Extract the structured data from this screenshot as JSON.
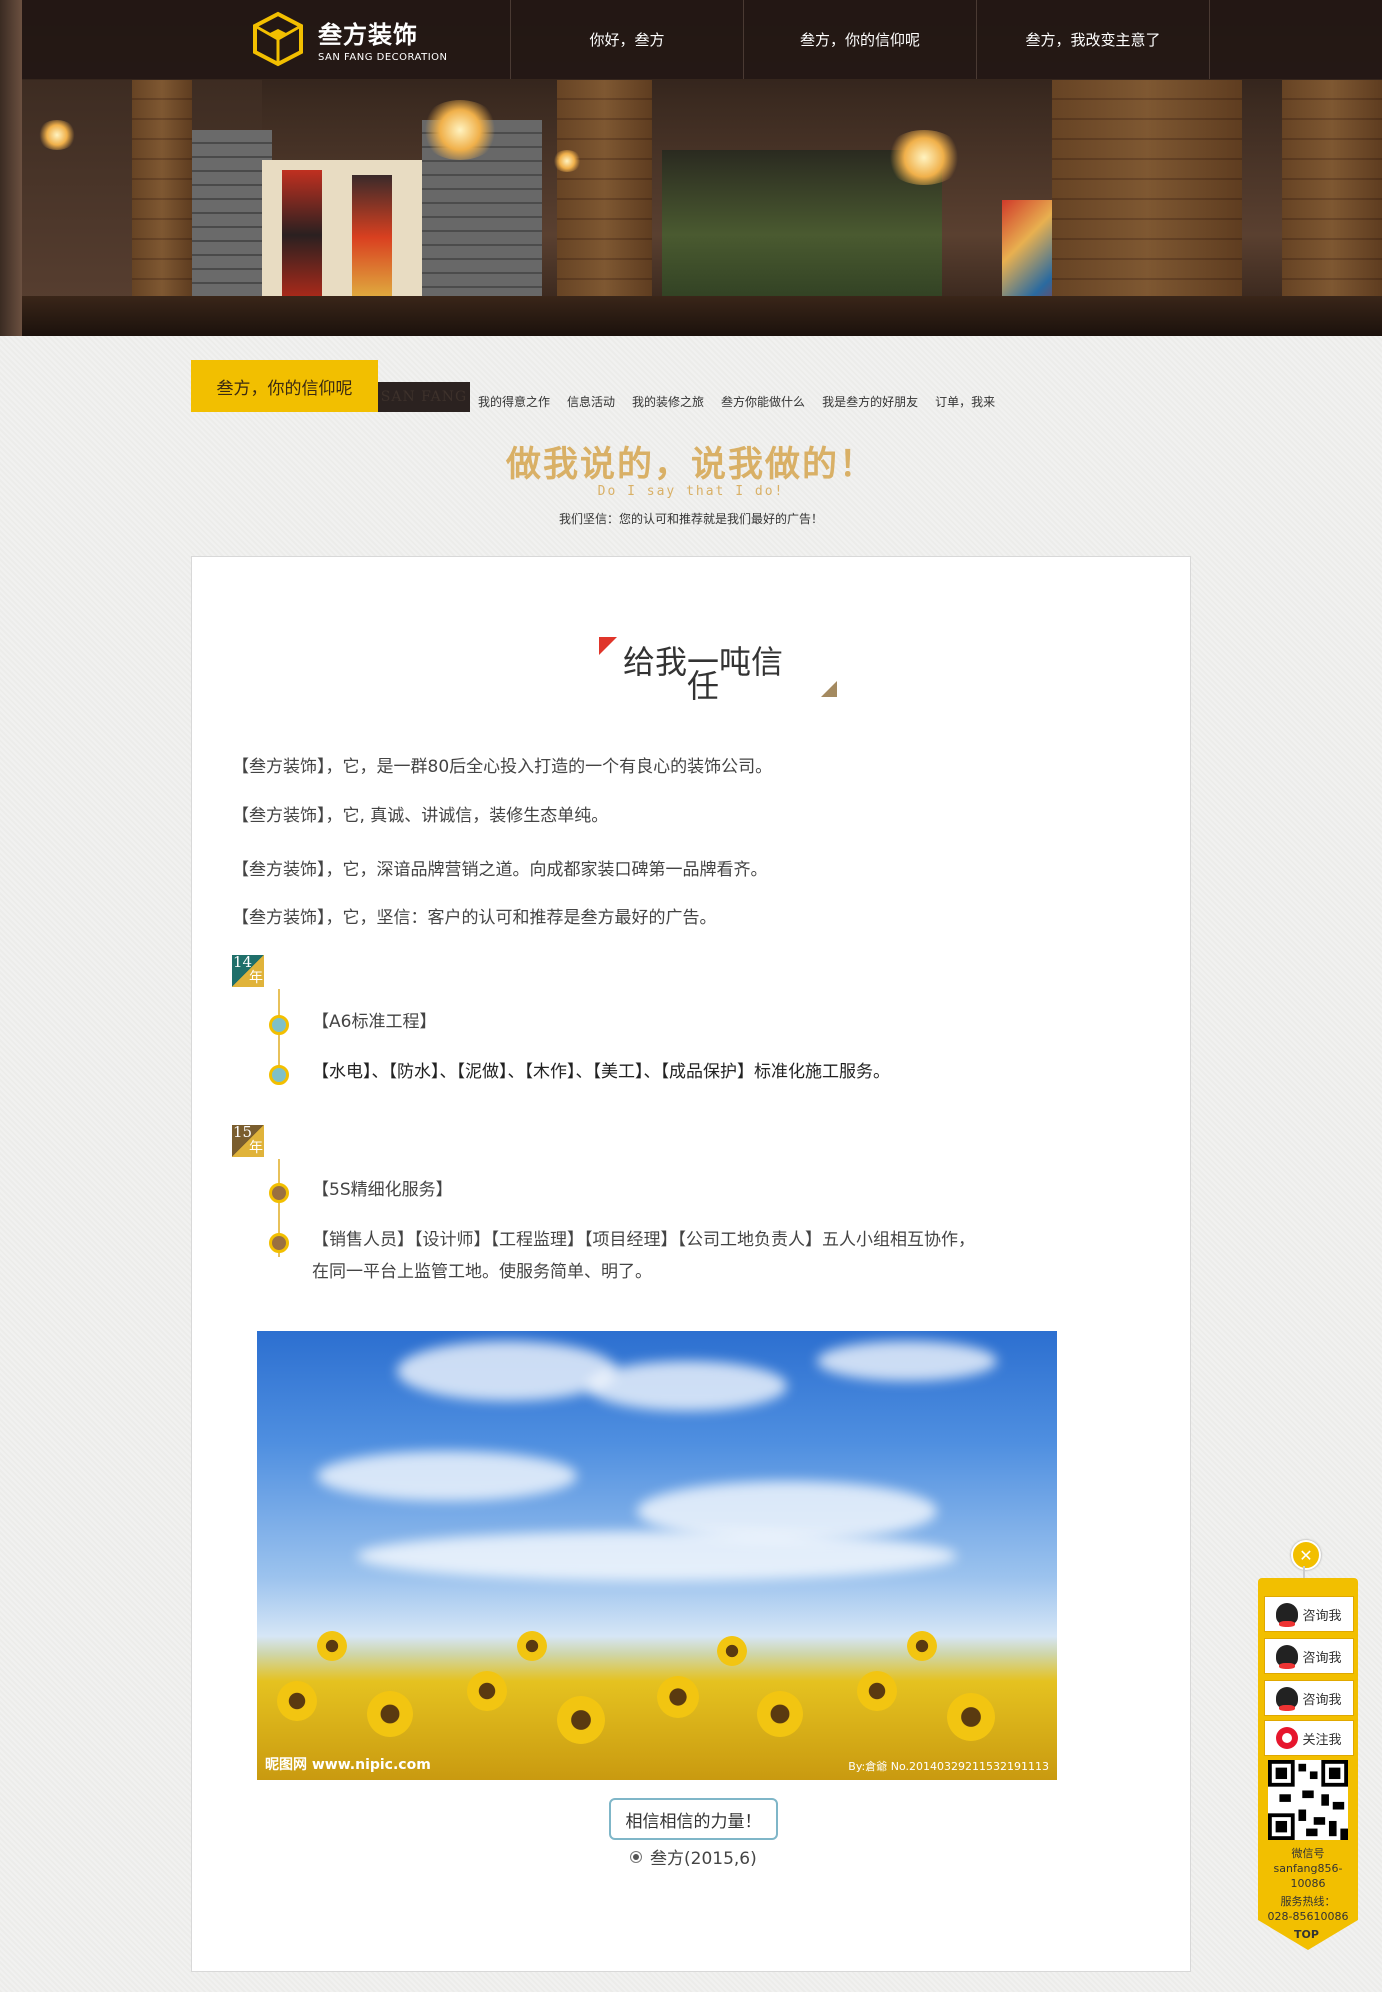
{
  "nav": {
    "logo_cn": "叁方装饰",
    "logo_en": "SAN FANG DECORATION",
    "items": [
      {
        "label": "你好，叁方"
      },
      {
        "label": "叁方，你的信仰呢"
      },
      {
        "label": "叁方，我改变主意了"
      }
    ]
  },
  "section": {
    "title": "叁方，你的信仰呢",
    "dark_label": "SAN FANG",
    "sub_nav": [
      {
        "label": "我的得意之作"
      },
      {
        "label": "信息活动"
      },
      {
        "label": "我的装修之旅"
      },
      {
        "label": "叁方你能做什么"
      },
      {
        "label": "我是叁方的好朋友"
      },
      {
        "label": "订单，我来"
      }
    ]
  },
  "slogan": {
    "cn": "做我说的，说我做的！",
    "en": "Do I say that I do!",
    "note": "我们坚信：您的认可和推荐就是我们最好的广告！"
  },
  "article": {
    "title_a": "给我",
    "title_b": "一",
    "title_c": "吨信",
    "title_d": "任",
    "paragraphs": [
      "【叁方装饰】，它，是一群80后全心投入打造的一个有良心的装饰公司。",
      "【叁方装饰】，它, 真诚、讲诚信，装修生态单纯。",
      "【叁方装饰】，它，深谙品牌营销之道。向成都家装口碑第一品牌看齐。",
      "【叁方装饰】，它，坚信：客户的认可和推荐是叁方最好的广告。"
    ],
    "timeline": [
      {
        "year_num": "14",
        "year_char": "年",
        "items": [
          "【A6标准工程】",
          "【水电】、【防水】、【泥做】、【木作】、【美工】、【成品保护】标准化施工服务。"
        ]
      },
      {
        "year_num": "15",
        "year_char": "年",
        "items": [
          "【5S精细化服务】",
          "【销售人员】【设计师】【工程监理】【项目经理】【公司工地负责人】五人小组相互协作，",
          "在同一平台上监管工地。使服务简单、明了。"
        ]
      }
    ],
    "photo_wm_left": "昵图网 www.nipic.com",
    "photo_wm_right": "By:倉爺 No.20140329211532191113",
    "caption": "相信相信的力量！",
    "signature": "叁方(2015,6)"
  },
  "float_bar": {
    "close": "✕",
    "buttons": [
      {
        "label": "咨询我",
        "icon": "qq-icon"
      },
      {
        "label": "咨询我",
        "icon": "qq-icon"
      },
      {
        "label": "咨询我",
        "icon": "qq-icon"
      },
      {
        "label": "关注我",
        "icon": "weibo-icon"
      }
    ],
    "wechat_label": "微信号",
    "wechat_id": "sanfang856-",
    "wechat_id2": "10086",
    "hotline_label": "服务热线：",
    "hotline": "028-85610086",
    "top": "TOP"
  },
  "colors": {
    "accent": "#f2bf00",
    "nav_bg": "#231814",
    "slogan": "#d9b066"
  }
}
